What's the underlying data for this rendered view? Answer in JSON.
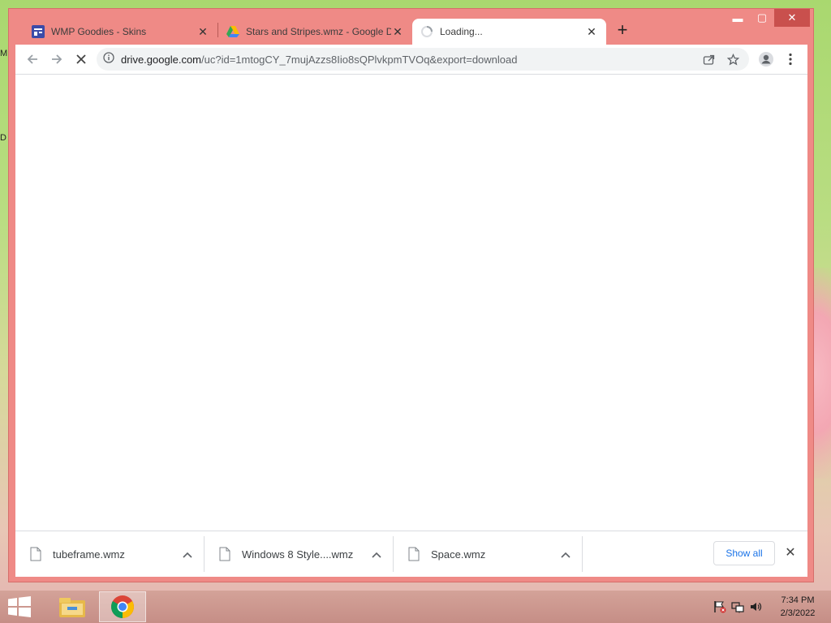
{
  "desktop": {
    "edge_letters": [
      "M",
      "D"
    ]
  },
  "window": {
    "controls": {
      "minimize": "▬",
      "maximize": "▢",
      "close": "✕"
    }
  },
  "tabs": [
    {
      "title": "WMP Goodies - Skins",
      "icon": "site-icon",
      "close": "✕",
      "active": false
    },
    {
      "title": "Stars and Stripes.wmz - Google D",
      "icon": "google-drive-icon",
      "close": "✕",
      "active": false
    },
    {
      "title": "Loading...",
      "icon": "loading-spinner-icon",
      "close": "✕",
      "active": true
    }
  ],
  "new_tab_label": "+",
  "toolbar": {
    "url_host": "drive.google.com",
    "url_path": "/uc?id=1mtogCY_7mujAzzs8Iio8sQPlvkpmTVOq&export=download",
    "icons": [
      "back-icon",
      "forward-icon",
      "stop-icon",
      "site-info-icon",
      "share-icon",
      "bookmark-star-icon",
      "profile-icon",
      "menu-icon"
    ]
  },
  "downloads": {
    "items": [
      {
        "name": "tubeframe.wmz"
      },
      {
        "name": "Windows 8 Style....wmz"
      },
      {
        "name": "Space.wmz"
      }
    ],
    "show_all": "Show all",
    "close": "✕"
  },
  "taskbar": {
    "apps": [
      "file-explorer-icon",
      "chrome-icon"
    ],
    "tray_icons": [
      "action-center-flag-icon",
      "network-icon",
      "volume-icon"
    ],
    "time": "7:34 PM",
    "date": "2/3/2022"
  },
  "colors": {
    "window_frame": "#ef8a86",
    "accent_link": "#1a73e8"
  }
}
